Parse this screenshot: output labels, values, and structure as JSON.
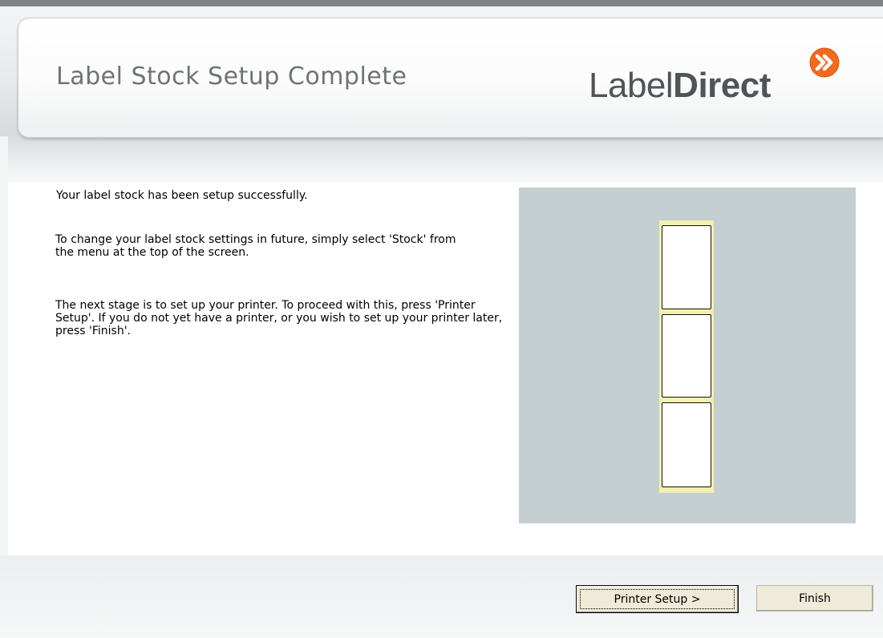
{
  "header": {
    "title": "Label Stock Setup Complete",
    "logo": {
      "text_regular": "Label",
      "text_bold": "Direct",
      "mark_icon": "double-chevron-right-icon",
      "mark_color": "#f26a1b"
    }
  },
  "messages": {
    "success": "Your label stock has been setup successfully.",
    "change_settings": "To change your label stock settings in future, simply select 'Stock' from the menu at the top of the screen.",
    "next_stage": "The next stage is to set up your printer. To proceed with this, press 'Printer Setup'. If you do not yet have a printer, or you wish to set up your printer later, press 'Finish'."
  },
  "preview": {
    "labels_across": 1,
    "labels_down": 3,
    "panel_color": "#c3cfd0",
    "sheet_color": "#f3f0b0"
  },
  "footer": {
    "printer_setup_label": "Printer Setup >",
    "finish_label": "Finish"
  }
}
